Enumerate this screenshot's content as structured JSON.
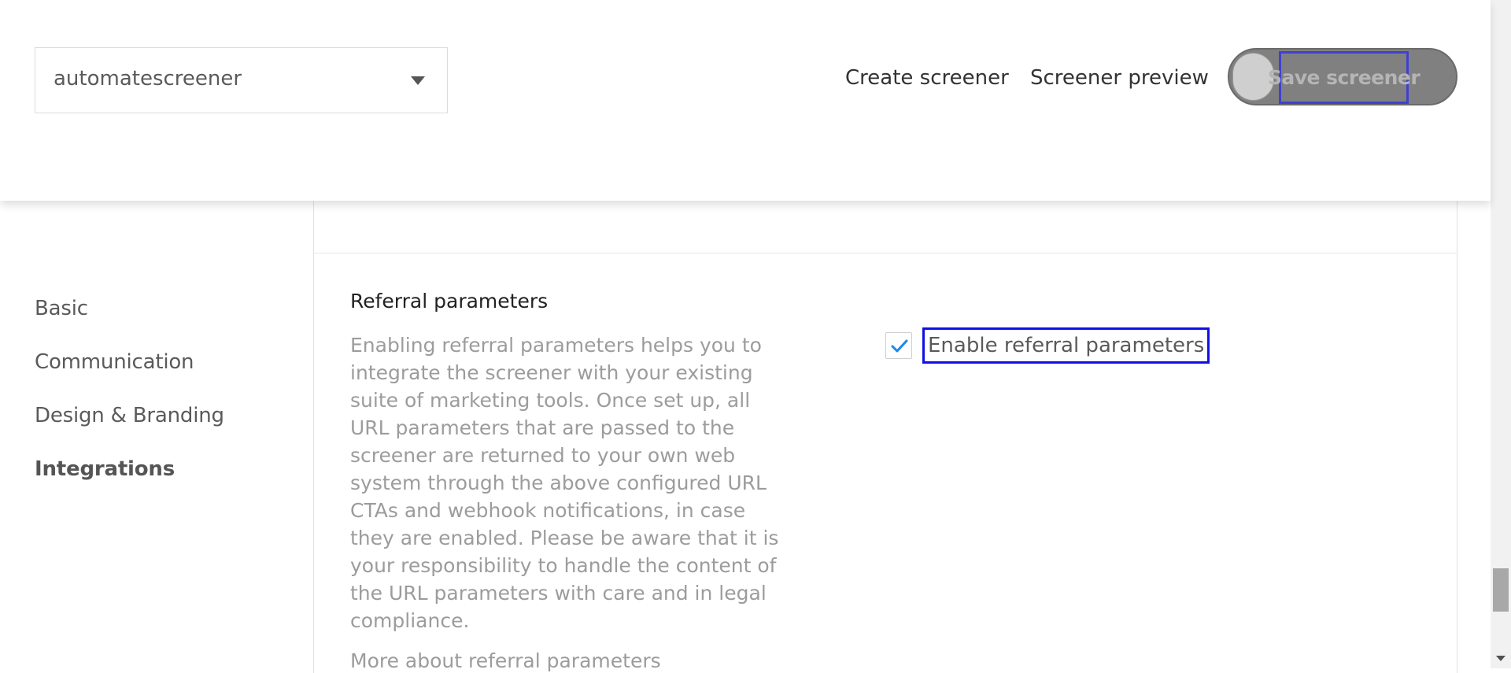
{
  "header": {
    "screener_select": {
      "value": "automatescreener"
    },
    "links": {
      "create": "Create screener",
      "preview": "Screener preview"
    },
    "save_button": {
      "label": "Save screener"
    }
  },
  "sidebar": {
    "items": [
      {
        "label": "Basic",
        "active": false
      },
      {
        "label": "Communication",
        "active": false
      },
      {
        "label": "Design & Branding",
        "active": false
      },
      {
        "label": "Integrations",
        "active": true
      }
    ]
  },
  "referral": {
    "title": "Referral parameters",
    "description": "Enabling referral parameters helps you to integrate the screener with your existing suite of marketing tools. Once set up, all URL parameters that are passed to the screener are returned to your own web system through the above configured URL CTAs and webhook notifications, in case they are enabled. Please be aware that it is your responsibility to handle the content of the URL parameters with care and in legal compliance.",
    "more_link": "More about referral parameters",
    "checkbox": {
      "label": "Enable referral parameters",
      "checked": true
    }
  },
  "colors": {
    "checkmark": "#1e88e5",
    "focus_outline": "#1010e6",
    "save_pill": "#808080"
  }
}
